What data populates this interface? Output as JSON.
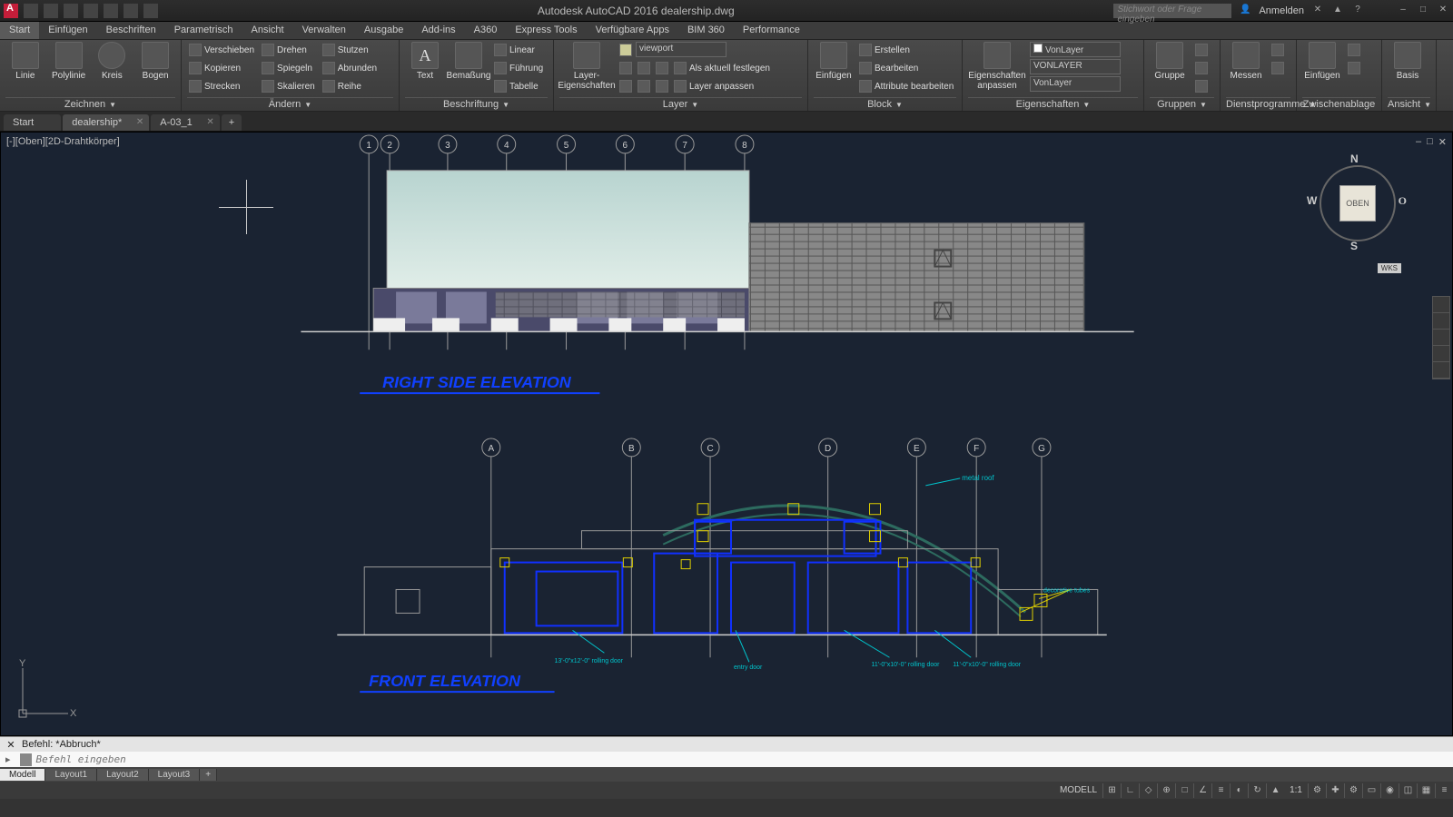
{
  "app": {
    "title": "Autodesk AutoCAD 2016   dealership.dwg",
    "search_placeholder": "Stichwort oder Frage eingeben",
    "signin": "Anmelden"
  },
  "tabs": {
    "items": [
      "Start",
      "Einfügen",
      "Beschriften",
      "Parametrisch",
      "Ansicht",
      "Verwalten",
      "Ausgabe",
      "Add-ins",
      "A360",
      "Express Tools",
      "Verfügbare Apps",
      "BIM 360",
      "Performance"
    ],
    "active": 0
  },
  "ribbon": {
    "draw": {
      "label": "Zeichnen",
      "line": "Linie",
      "polyline": "Polylinie",
      "circle": "Kreis",
      "arc": "Bogen"
    },
    "modify": {
      "label": "Ändern",
      "move": "Verschieben",
      "copy": "Kopieren",
      "stretch": "Strecken",
      "rotate": "Drehen",
      "mirror": "Spiegeln",
      "scale": "Skalieren",
      "trim": "Stutzen",
      "fillet": "Abrunden",
      "array": "Reihe"
    },
    "annot": {
      "label": "Beschriftung",
      "text": "Text",
      "dim": "Bemaßung",
      "leader": "Führung",
      "linear": "Linear",
      "table": "Tabelle"
    },
    "layers": {
      "label": "Layer",
      "props": "Layer-\nEigenschaften",
      "current": "viewport",
      "match": "Als aktuell festlegen",
      "adjust": "Layer anpassen"
    },
    "block": {
      "label": "Block",
      "insert": "Einfügen",
      "create": "Erstellen",
      "edit": "Bearbeiten",
      "attr": "Attribute bearbeiten"
    },
    "props": {
      "label": "Eigenschaften",
      "btn": "Eigenschaften\nanpassen",
      "color": "VonLayer",
      "lw": "VONLAYER",
      "lt": "VonLayer"
    },
    "groups": {
      "label": "Gruppen",
      "btn": "Gruppe"
    },
    "utils": {
      "label": "Dienstprogramme",
      "measure": "Messen"
    },
    "clip": {
      "label": "Zwischenablage",
      "paste": "Einfügen"
    },
    "view": {
      "label": "Ansicht",
      "base": "Basis"
    }
  },
  "filetabs": {
    "items": [
      "Start",
      "dealership*",
      "A-03_1"
    ],
    "active": 1
  },
  "viewport": {
    "label": "[-][Oben][2D-Drahtkörper]",
    "cube": "OBEN",
    "wks": "WKS"
  },
  "drawing": {
    "elev1_title": "RIGHT SIDE ELEVATION",
    "elev1_grids": [
      "1",
      "2",
      "3",
      "4",
      "5",
      "6",
      "7",
      "8"
    ],
    "elev2_title": "FRONT ELEVATION",
    "elev2_grids": [
      "A",
      "B",
      "C",
      "D",
      "E",
      "F",
      "G"
    ],
    "note_roof": "metal roof",
    "note_door1": "entry door",
    "note_door2": "11'-0\"x10'-0\" rolling door",
    "note_door3": "13'-0\"x12'-0\" rolling door",
    "note_door4": "decorative tubes"
  },
  "cmd": {
    "history": "Befehl: *Abbruch*",
    "placeholder": "Befehl eingeben"
  },
  "layouts": {
    "items": [
      "Modell",
      "Layout1",
      "Layout2",
      "Layout3"
    ],
    "active": 0
  },
  "status": {
    "model": "MODELL",
    "scale": "1:1"
  }
}
